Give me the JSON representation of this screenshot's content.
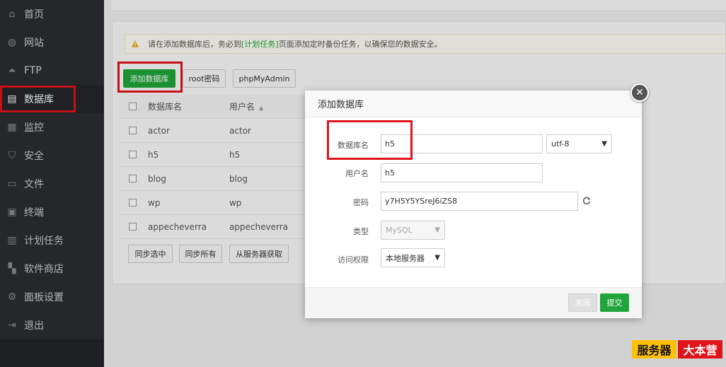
{
  "sidebar": {
    "items": [
      {
        "label": "首页",
        "icon": "home-icon",
        "glyph": "⌂"
      },
      {
        "label": "网站",
        "icon": "globe-icon",
        "glyph": "◍"
      },
      {
        "label": "FTP",
        "icon": "ftp-icon",
        "glyph": "⏶"
      },
      {
        "label": "数据库",
        "icon": "database-icon",
        "glyph": "▤",
        "active": true
      },
      {
        "label": "监控",
        "icon": "monitor-icon",
        "glyph": "▦"
      },
      {
        "label": "安全",
        "icon": "shield-icon",
        "glyph": "⛉"
      },
      {
        "label": "文件",
        "icon": "folder-icon",
        "glyph": "▭"
      },
      {
        "label": "终端",
        "icon": "terminal-icon",
        "glyph": "▣"
      },
      {
        "label": "计划任务",
        "icon": "calendar-icon",
        "glyph": "▥"
      },
      {
        "label": "软件商店",
        "icon": "apps-icon",
        "glyph": "▚"
      },
      {
        "label": "面板设置",
        "icon": "gear-icon",
        "glyph": "⚙"
      },
      {
        "label": "退出",
        "icon": "logout-icon",
        "glyph": "⇥"
      }
    ]
  },
  "notice": {
    "prefix": "请在添加数据库后，务必到",
    "link": "[计划任务]",
    "suffix": "页面添加定时备份任务，以确保您的数据安全。"
  },
  "toolbar": {
    "add_db": "添加数据库",
    "root_pwd": "root密码",
    "phpmyadmin": "phpMyAdmin"
  },
  "table": {
    "headers": [
      "数据库名",
      "用户名"
    ],
    "rows": [
      {
        "name": "actor",
        "user": "actor"
      },
      {
        "name": "h5",
        "user": "h5"
      },
      {
        "name": "blog",
        "user": "blog"
      },
      {
        "name": "wp",
        "user": "wp"
      },
      {
        "name": "appecheverra",
        "user": "appecheverra"
      }
    ]
  },
  "actions": {
    "sync_selected": "同步选中",
    "sync_all": "同步所有",
    "fetch_from_server": "从服务器获取"
  },
  "modal": {
    "title": "添加数据库",
    "close_glyph": "✕",
    "fields": {
      "db_name_label": "数据库名",
      "db_name_value": "h5",
      "charset_value": "utf-8",
      "username_label": "用户名",
      "username_value": "h5",
      "password_label": "密码",
      "password_value": "y7H5Y5YSreJ6iZS8",
      "type_label": "类型",
      "type_value": "MySQL",
      "access_label": "访问权限",
      "access_value": "本地服务器"
    },
    "buttons": {
      "close": "关闭",
      "submit": "提交"
    }
  },
  "watermark": {
    "part1": "服务器",
    "part2": "大本营"
  },
  "colors": {
    "accent_green": "#20a53a",
    "highlight_red": "#e0141b",
    "sidebar_bg": "#2b2d31"
  }
}
